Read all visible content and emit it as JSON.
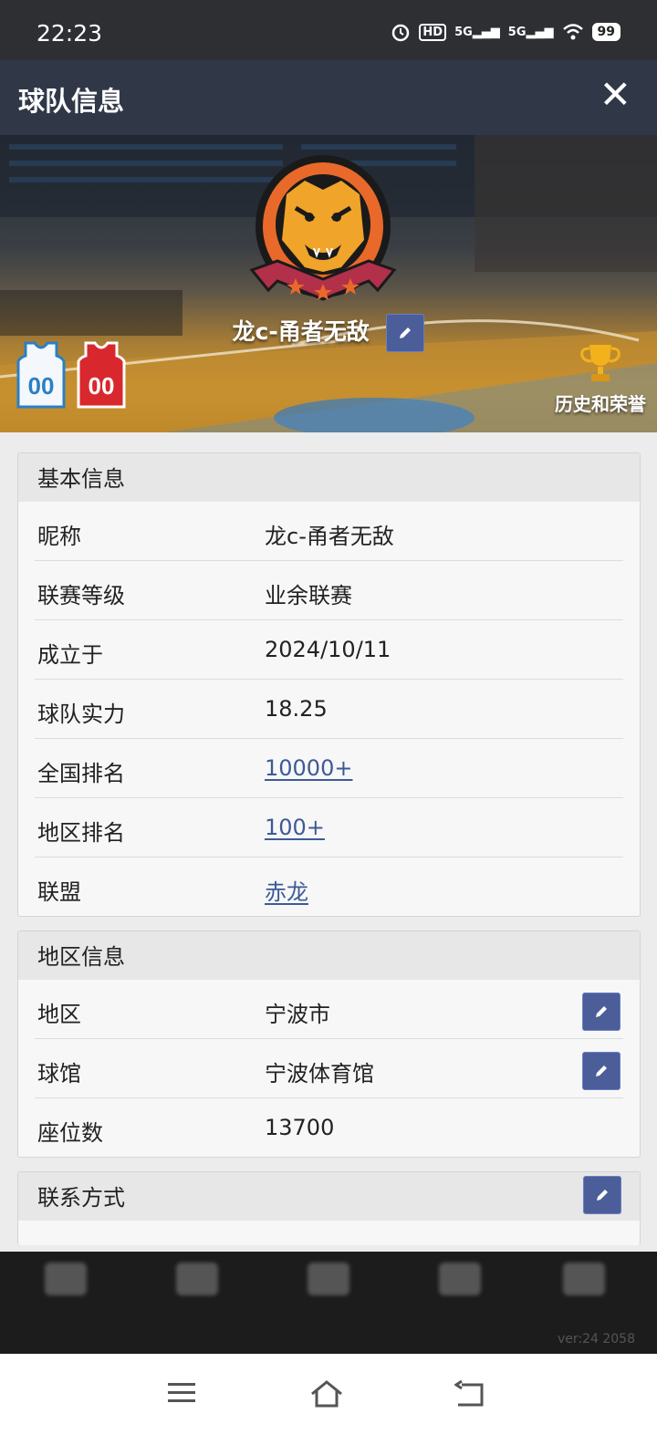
{
  "status_bar": {
    "time": "22:23",
    "network1": "5G",
    "network2": "5G",
    "battery": "99",
    "hd": "HD"
  },
  "header": {
    "title": "球队信息",
    "close_label": "✕"
  },
  "banner": {
    "team_name": "龙c-甬者无敌",
    "jersey_home_number": "00",
    "jersey_away_number": "00",
    "honors_label": "历史和荣誉",
    "edit_icon": "pencil-icon"
  },
  "basic_info": {
    "title": "基本信息",
    "rows": [
      {
        "label": "昵称",
        "value": "龙c-甬者无敌"
      },
      {
        "label": "联赛等级",
        "value": "业余联赛"
      },
      {
        "label": "成立于",
        "value": "2024/10/11"
      },
      {
        "label": "球队实力",
        "value": "18.25"
      },
      {
        "label": "全国排名",
        "value": "10000+"
      },
      {
        "label": "地区排名",
        "value": "100+"
      },
      {
        "label": "联盟",
        "value": "赤龙"
      }
    ]
  },
  "region_info": {
    "title": "地区信息",
    "rows": [
      {
        "label": "地区",
        "value": "宁波市"
      },
      {
        "label": "球馆",
        "value": "宁波体育馆"
      },
      {
        "label": "座位数",
        "value": "13700"
      }
    ]
  },
  "contact": {
    "title": "联系方式"
  },
  "footer": {
    "version": "ver:24  2058"
  },
  "colors": {
    "header_bg": "#303848",
    "link": "#3d5a96",
    "edit_button": "#4b5e99",
    "logo_orange": "#e8692a",
    "ribbon": "#b3304a"
  }
}
